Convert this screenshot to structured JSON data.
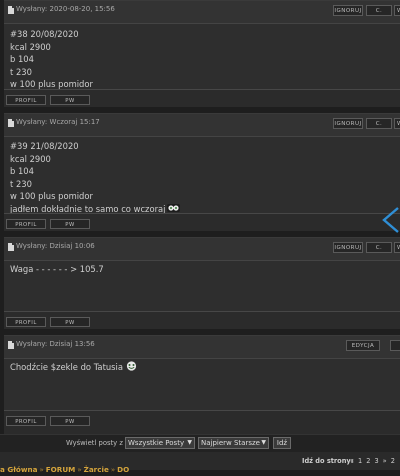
{
  "posts": [
    {
      "date": "Wysłany: 2020-08-20, 15:56",
      "buttons": [
        "IGNORUJ",
        "C.",
        "W"
      ],
      "lines": [
        "#38 20/08/2020",
        "kcal 2900",
        "b 104",
        "t 230",
        "w 100 plus pomidor"
      ],
      "footer": [
        "PROFIL",
        "PW"
      ]
    },
    {
      "date": "Wysłany: Wczoraj 15:17",
      "buttons": [
        "IGNORUJ",
        "C.",
        "W"
      ],
      "lines": [
        "#39 21/08/2020",
        "kcal 2900",
        "b 104",
        "t 230",
        "w 100 plus pomidor",
        "jadłem dokładnie to samo co wczoraj"
      ],
      "footer": [
        "PROFIL",
        "PW"
      ]
    },
    {
      "date": "Wysłany: Dzisiaj 10:06",
      "buttons": [
        "IGNORUJ",
        "C.",
        "W"
      ],
      "lines": [
        "Waga - - - - - - > 105.7"
      ],
      "footer": [
        "PROFIL",
        "PW"
      ]
    },
    {
      "date": "Wysłany: Dzisiaj 13:56",
      "buttons": [
        "EDYCJA"
      ],
      "lines": [
        "Chodźcie $zekle do Tatusia"
      ],
      "footer": [
        "PROFIL",
        "PW"
      ]
    }
  ],
  "filter": {
    "label": "Wyświetl posty z ostatnich:",
    "period": "Wszystkie Posty",
    "order": "Najpierw Starsze",
    "go": "Idź"
  },
  "breadcrumb": [
    "a Główna",
    "FORUM",
    "Żarcie",
    "DO"
  ],
  "pagination": {
    "label": "Idź do strony:",
    "items": [
      "«",
      "1",
      "2",
      "3",
      "»",
      "2"
    ]
  },
  "colors": {
    "accent": "#2f8fd6",
    "breadcrumb": "#d4a43c"
  }
}
